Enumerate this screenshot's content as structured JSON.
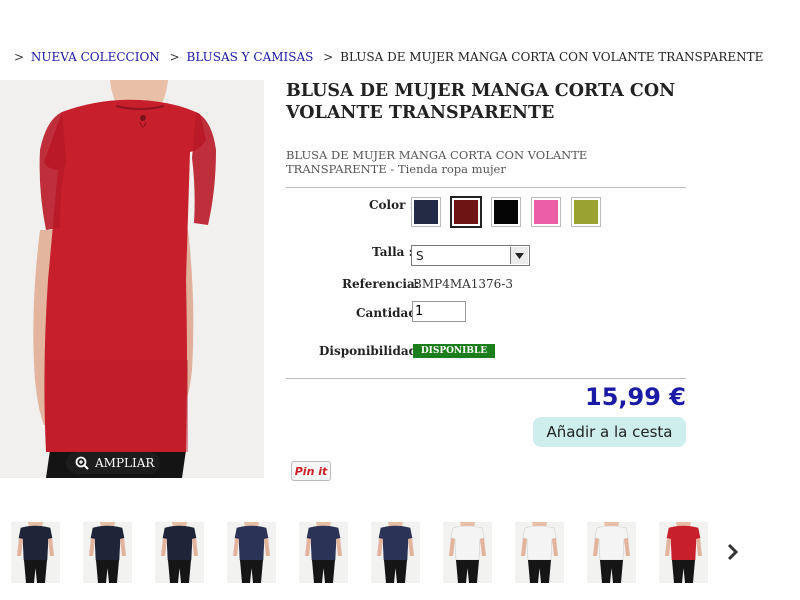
{
  "breadcrumb": {
    "sep": ">",
    "links": [
      "NUEVA COLECCION",
      "BLUSAS Y CAMISAS"
    ],
    "current": "BLUSA DE MUJER MANGA CORTA CON VOLANTE TRANSPARENTE"
  },
  "product": {
    "title": "BLUSA DE MUJER MANGA CORTA CON VOLANTE TRANSPARENTE",
    "subtitle": "BLUSA DE MUJER MANGA CORTA CON VOLANTE TRANSPARENTE - Tienda ropa mujer",
    "color_label": "Color :",
    "colors": [
      {
        "name": "navy",
        "hex": "#232b45",
        "selected": false
      },
      {
        "name": "burgundy",
        "hex": "#6e1414",
        "selected": true
      },
      {
        "name": "black",
        "hex": "#050505",
        "selected": false
      },
      {
        "name": "pink",
        "hex": "#ec5fa6",
        "selected": false
      },
      {
        "name": "olive",
        "hex": "#9aa232",
        "selected": false
      }
    ],
    "size_label": "Talla :",
    "size_value": "S",
    "ref_label": "Referencia:",
    "ref_value": "BMP4MA1376-3",
    "qty_label": "Cantidad",
    "qty_value": "1",
    "avail_label": "Disponibilidad:",
    "avail_value": "DISPONIBLE",
    "price": "15,99 €",
    "add_to_cart": "Añadir a la cesta",
    "zoom_label": "AMPLIAR",
    "pin_label": "Pin it",
    "main_color": "#c81f2d"
  },
  "thumbnails": [
    {
      "top": "#1f2438",
      "tone": "dark"
    },
    {
      "top": "#1f2438",
      "tone": "dark"
    },
    {
      "top": "#1f2438",
      "tone": "dark"
    },
    {
      "top": "#2a3457",
      "tone": "dark"
    },
    {
      "top": "#2a3457",
      "tone": "dark"
    },
    {
      "top": "#2a3457",
      "tone": "dark"
    },
    {
      "top": "#f4f4f4",
      "tone": "light"
    },
    {
      "top": "#f4f4f4",
      "tone": "light"
    },
    {
      "top": "#f4f4f4",
      "tone": "light"
    },
    {
      "top": "#c81f2d",
      "tone": "dark"
    }
  ],
  "icons": {
    "zoom": "zoom-in-icon",
    "next": "chevron-right-icon",
    "dropdown": "dropdown-arrow-icon"
  }
}
